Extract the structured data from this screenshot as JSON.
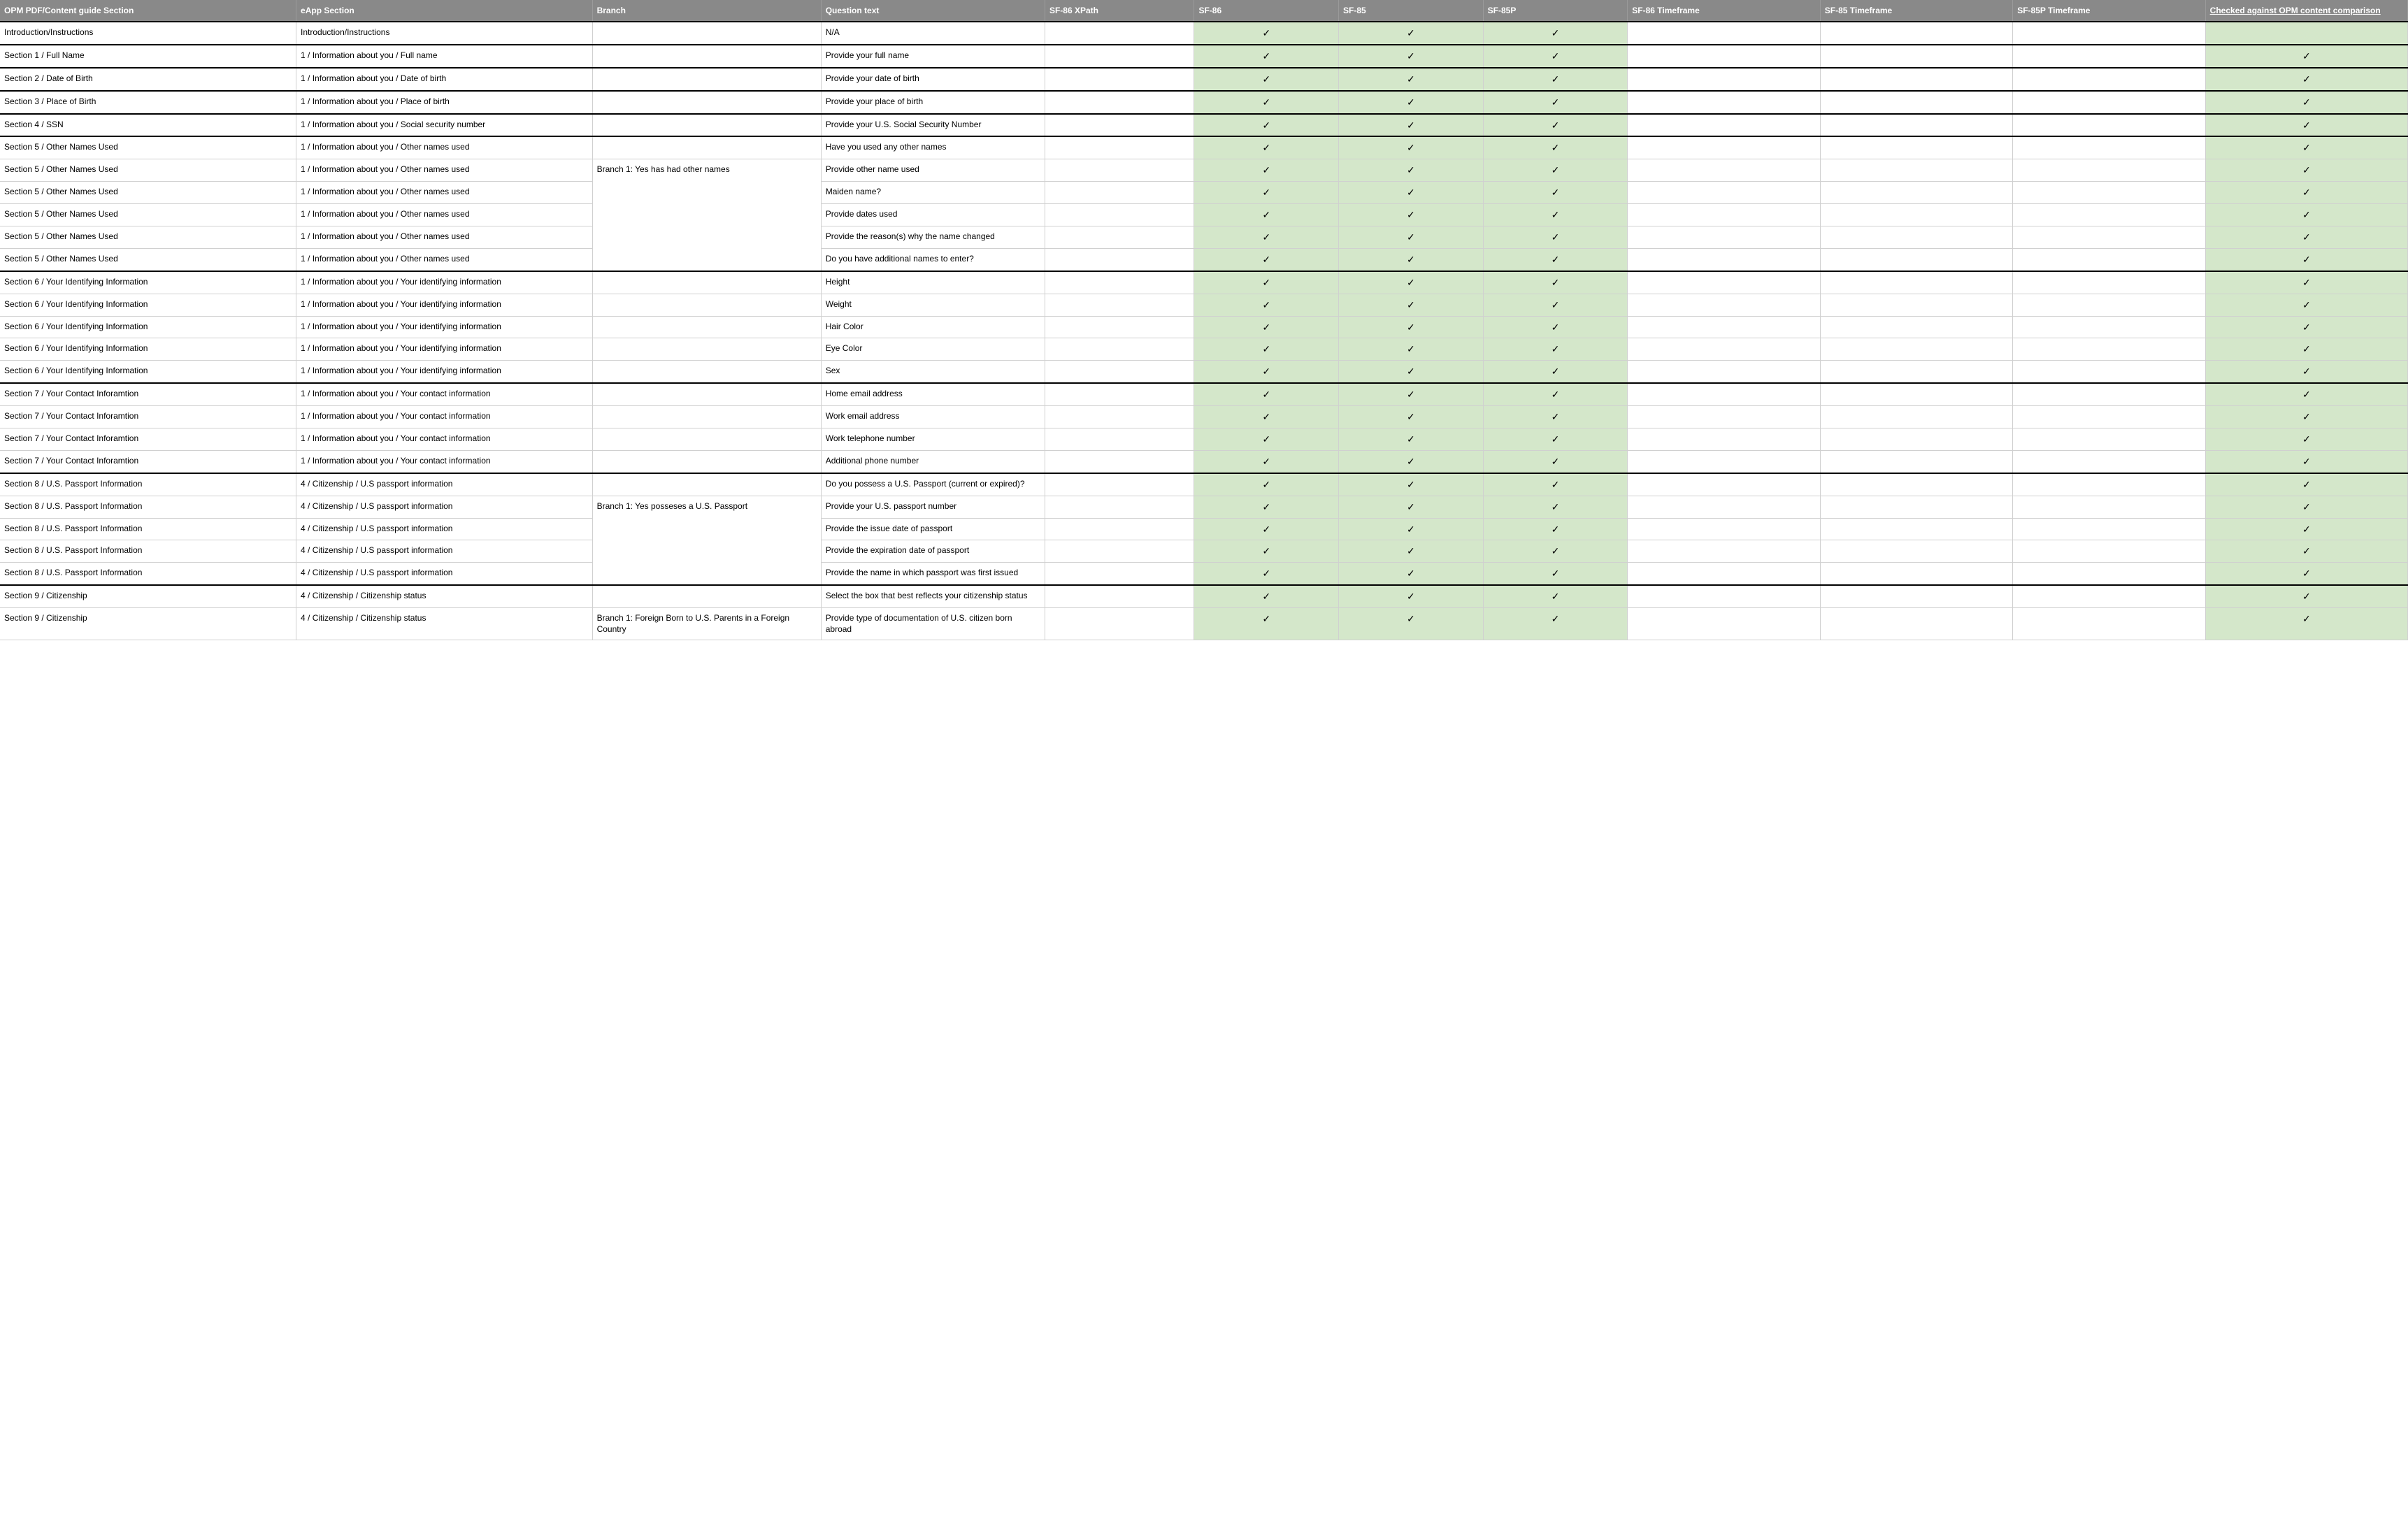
{
  "headers": {
    "opm": "OPM PDF/Content guide Section",
    "eapp": "eApp Section",
    "branch": "Branch",
    "qtext": "Question text",
    "xpath": "SF-86 XPath",
    "sf86": "SF-86",
    "sf85": "SF-85",
    "sf85p": "SF-85P",
    "tf86": "SF-86 Timeframe",
    "tf85": "SF-85 Timeframe",
    "tf85p": "SF-85P Timeframe",
    "checked": "Checked against OPM content comparison"
  },
  "check": "✓",
  "rows": [
    {
      "sec": true,
      "opm": "Introduction/Instructions",
      "eapp": "Introduction/Instructions",
      "branch": "",
      "qtext": "N/A",
      "sf86": true,
      "sf85": true,
      "sf85p": true,
      "chk": false
    },
    {
      "sec": true,
      "opm": "Section 1 / Full Name",
      "eapp": "1 / Information about you / Full name",
      "branch": "",
      "qtext": "Provide your full name",
      "sf86": true,
      "sf85": true,
      "sf85p": true,
      "chk": true
    },
    {
      "sec": true,
      "opm": "Section 2 / Date of Birth",
      "eapp": "1 / Information about you / Date of birth",
      "branch": "",
      "qtext": "Provide your date of birth",
      "sf86": true,
      "sf85": true,
      "sf85p": true,
      "chk": true
    },
    {
      "sec": true,
      "opm": "Section 3 / Place of Birth",
      "eapp": "1 / Information about you / Place of birth",
      "branch": "",
      "qtext": "Provide your place of birth",
      "sf86": true,
      "sf85": true,
      "sf85p": true,
      "chk": true
    },
    {
      "sec": true,
      "opm": "Section 4  / SSN",
      "eapp": "1 / Information about you / Social security number",
      "branch": "",
      "qtext": "Provide your U.S. Social Security Number",
      "sf86": true,
      "sf85": true,
      "sf85p": true,
      "chk": true
    },
    {
      "sec": true,
      "opm": "Section 5 / Other Names Used",
      "eapp": "1 / Information about you / Other names used",
      "branch": "",
      "qtext": "Have you used any other names",
      "sf86": true,
      "sf85": true,
      "sf85p": true,
      "chk": true
    },
    {
      "sec": false,
      "opm": "Section 5 / Other Names Used",
      "eapp": "1 / Information about you / Other names used",
      "branch": "Branch 1: Yes has had other names",
      "branchSpan": 5,
      "qtext": "Provide other name used",
      "sf86": true,
      "sf85": true,
      "sf85p": true,
      "chk": true
    },
    {
      "sec": false,
      "opm": "Section 5 / Other Names Used",
      "eapp": "1 / Information about you / Other names used",
      "branchSkip": true,
      "qtext": "Maiden name?",
      "sf86": true,
      "sf85": true,
      "sf85p": true,
      "chk": true
    },
    {
      "sec": false,
      "opm": "Section 5 / Other Names Used",
      "eapp": "1 / Information about you / Other names used",
      "branchSkip": true,
      "qtext": "Provide dates used",
      "sf86": true,
      "sf85": true,
      "sf85p": true,
      "chk": true
    },
    {
      "sec": false,
      "opm": "Section 5 / Other Names Used",
      "eapp": "1 / Information about you / Other names used",
      "branchSkip": true,
      "qtext": "Provide the reason(s) why the name changed",
      "sf86": true,
      "sf85": true,
      "sf85p": true,
      "chk": true
    },
    {
      "sec": false,
      "opm": "Section 5 / Other Names Used",
      "eapp": "1 / Information about you / Other names used",
      "branchSkip": true,
      "qtext": "Do you have additional names to enter?",
      "sf86": true,
      "sf85": true,
      "sf85p": true,
      "chk": true
    },
    {
      "sec": true,
      "opm": "Section 6 / Your Identifying Information",
      "eapp": "1 / Information about you / Your identifying information",
      "branch": "",
      "qtext": "Height",
      "sf86": true,
      "sf85": true,
      "sf85p": true,
      "chk": true
    },
    {
      "sec": false,
      "opm": "Section 6 / Your Identifying Information",
      "eapp": "1 / Information about you / Your identifying information",
      "branch": "",
      "qtext": "Weight",
      "sf86": true,
      "sf85": true,
      "sf85p": true,
      "chk": true
    },
    {
      "sec": false,
      "opm": "Section 6 / Your Identifying Information",
      "eapp": "1 / Information about you / Your identifying information",
      "branch": "",
      "qtext": "Hair Color",
      "sf86": true,
      "sf85": true,
      "sf85p": true,
      "chk": true
    },
    {
      "sec": false,
      "opm": "Section 6 / Your Identifying Information",
      "eapp": "1 / Information about you / Your identifying information",
      "branch": "",
      "qtext": "Eye Color",
      "sf86": true,
      "sf85": true,
      "sf85p": true,
      "chk": true
    },
    {
      "sec": false,
      "opm": "Section 6 / Your Identifying Information",
      "eapp": "1 / Information about you / Your identifying information",
      "branch": "",
      "qtext": "Sex",
      "sf86": true,
      "sf85": true,
      "sf85p": true,
      "chk": true
    },
    {
      "sec": true,
      "opm": "Section 7 / Your Contact Inforamtion",
      "eapp": "1 / Information about you / Your contact information",
      "branch": "",
      "qtext": "Home email address",
      "sf86": true,
      "sf85": true,
      "sf85p": true,
      "chk": true
    },
    {
      "sec": false,
      "opm": "Section 7 / Your Contact Inforamtion",
      "eapp": "1 / Information about you / Your contact information",
      "branch": "",
      "qtext": "Work email address",
      "sf86": true,
      "sf85": true,
      "sf85p": true,
      "chk": true
    },
    {
      "sec": false,
      "opm": "Section 7 / Your Contact Inforamtion",
      "eapp": "1 / Information about you / Your contact information",
      "branch": "",
      "qtext": "Work telephone number",
      "sf86": true,
      "sf85": true,
      "sf85p": true,
      "chk": true
    },
    {
      "sec": false,
      "opm": "Section 7 / Your Contact Inforamtion",
      "eapp": "1 / Information about you / Your contact information",
      "branch": "",
      "qtext": "Additional phone number",
      "sf86": true,
      "sf85": true,
      "sf85p": true,
      "chk": true
    },
    {
      "sec": true,
      "opm": "Section 8 / U.S. Passport Information",
      "eapp": "4 / Citizenship / U.S passport information",
      "branch": "",
      "qtext": "Do you possess a U.S. Passport (current or expired)?",
      "sf86": true,
      "sf85": true,
      "sf85p": true,
      "chk": true
    },
    {
      "sec": false,
      "opm": "Section 8 / U.S. Passport Information",
      "eapp": "4 / Citizenship / U.S passport information",
      "branch": "Branch 1: Yes posseses a U.S. Passport",
      "branchSpan": 4,
      "qtext": "Provide your U.S. passport number",
      "sf86": true,
      "sf85": true,
      "sf85p": true,
      "chk": true
    },
    {
      "sec": false,
      "opm": "Section 8 / U.S. Passport Information",
      "eapp": "4 / Citizenship / U.S passport information",
      "branchSkip": true,
      "qtext": "Provide the issue date of passport",
      "sf86": true,
      "sf85": true,
      "sf85p": true,
      "chk": true
    },
    {
      "sec": false,
      "opm": "Section 8 / U.S. Passport Information",
      "eapp": "4 / Citizenship / U.S passport information",
      "branchSkip": true,
      "qtext": "Provide the expiration date of passport",
      "sf86": true,
      "sf85": true,
      "sf85p": true,
      "chk": true
    },
    {
      "sec": false,
      "opm": "Section 8 / U.S. Passport Information",
      "eapp": "4 / Citizenship / U.S passport information",
      "branchSkip": true,
      "qtext": "Provide the name in which passport was first issued",
      "sf86": true,
      "sf85": true,
      "sf85p": true,
      "chk": true
    },
    {
      "sec": true,
      "opm": "Section 9 / Citizenship",
      "eapp": "4 / Citizenship / Citizenship status",
      "branch": "",
      "qtext": "Select the box that best reflects your citizenship status",
      "sf86": true,
      "sf85": true,
      "sf85p": true,
      "chk": true
    },
    {
      "sec": false,
      "opm": "Section 9 / Citizenship",
      "eapp": "4 / Citizenship / Citizenship status",
      "branch": "Branch 1: Foreign Born to U.S. Parents in a Foreign Country",
      "qtext": "Provide type of documentation of U.S. citizen born abroad",
      "sf86": true,
      "sf85": true,
      "sf85p": true,
      "chk": true
    }
  ]
}
